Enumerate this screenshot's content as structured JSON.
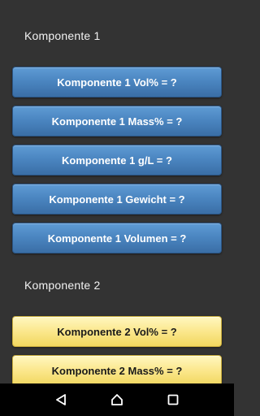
{
  "sections": [
    {
      "title": "Komponente 1",
      "style": "blue",
      "buttons": [
        "Komponente 1 Vol% = ?",
        "Komponente 1 Mass% = ?",
        "Komponente 1 g/L = ?",
        "Komponente 1 Gewicht = ?",
        "Komponente 1 Volumen = ?"
      ]
    },
    {
      "title": "Komponente 2",
      "style": "yellow",
      "buttons": [
        "Komponente 2 Vol% = ?",
        "Komponente 2 Mass% = ?"
      ]
    }
  ],
  "navbar": {
    "back": "back-icon",
    "home": "home-icon",
    "recents": "recents-icon"
  },
  "colors": {
    "background": "#333333",
    "blue_button": "#4b86c1",
    "yellow_button": "#fbe78c",
    "navbar": "#000000"
  }
}
